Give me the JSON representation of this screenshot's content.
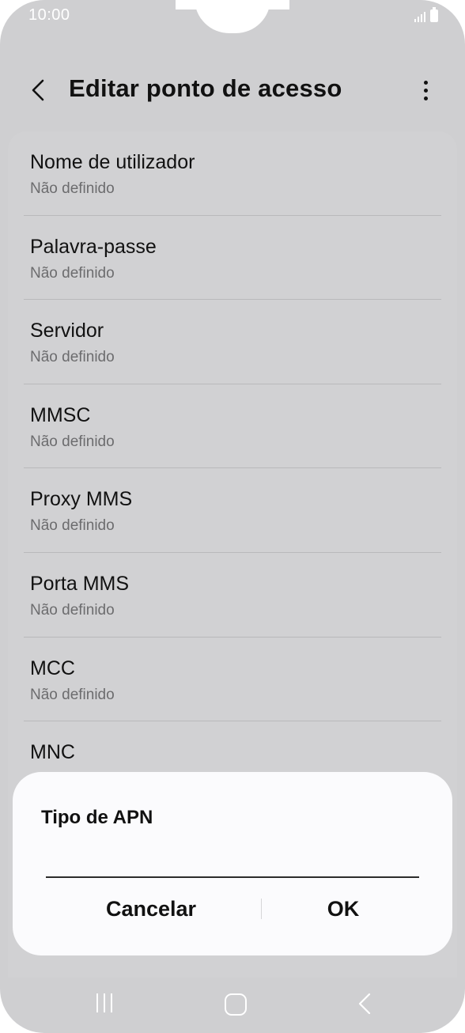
{
  "status_bar": {
    "time": "10:00",
    "icons": [
      "signal-icon",
      "battery-icon"
    ]
  },
  "header": {
    "title": "Editar ponto de acesso",
    "back_icon": "chevron-left-icon",
    "more_icon": "more-vertical-icon"
  },
  "settings": {
    "items": [
      {
        "title": "Nome de utilizador",
        "value": "Não definido"
      },
      {
        "title": "Palavra-passe",
        "value": "Não definido"
      },
      {
        "title": "Servidor",
        "value": "Não definido"
      },
      {
        "title": "MMSC",
        "value": "Não definido"
      },
      {
        "title": "Proxy MMS",
        "value": "Não definido"
      },
      {
        "title": "Porta MMS",
        "value": "Não definido"
      },
      {
        "title": "MCC",
        "value": "Não definido"
      },
      {
        "title": "MNC",
        "value": ""
      }
    ]
  },
  "dialog": {
    "title": "Tipo de APN",
    "input_value": "",
    "cancel_label": "Cancelar",
    "ok_label": "OK"
  },
  "nav_bar": {
    "icons": [
      "recents-icon",
      "home-icon",
      "back-icon"
    ]
  },
  "colors": {
    "background": "#cfcfd1",
    "dialog_background": "#fbfbfd",
    "text_primary": "#111111",
    "text_secondary": "#6c6c6e"
  }
}
